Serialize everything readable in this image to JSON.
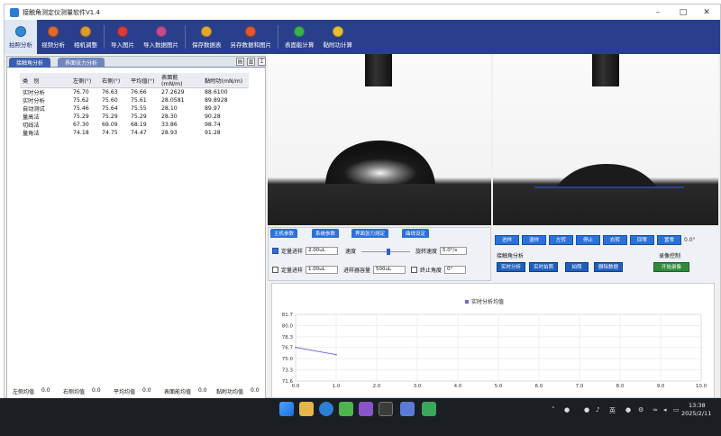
{
  "window": {
    "title": "接触角测定仪测量软件V1.4",
    "controls": [
      "–",
      "□",
      "✕"
    ]
  },
  "toolbar": {
    "items": [
      {
        "label": "拍照分析",
        "icon": "camera-icon",
        "color": "#2f8ad0"
      },
      {
        "label": "视频分析",
        "icon": "video-icon",
        "color": "#e06a2c"
      },
      {
        "label": "相机调整",
        "icon": "camera-adjust-icon",
        "color": "#e09a2c"
      },
      {
        "label": "导入图片",
        "icon": "import-image-icon",
        "color": "#d83b3b"
      },
      {
        "label": "导入数据图片",
        "icon": "import-data-image-icon",
        "color": "#c74b8c"
      },
      {
        "label": "保存数据表",
        "icon": "save-table-icon",
        "color": "#e0a82c"
      },
      {
        "label": "另存数据和图片",
        "icon": "save-as-icon",
        "color": "#e05a2c"
      },
      {
        "label": "表面能计算",
        "icon": "surface-energy-icon",
        "color": "#3cb04f"
      },
      {
        "label": "黏附功计算",
        "icon": "adhesion-work-icon",
        "color": "#e8c02c"
      }
    ]
  },
  "left_tabs": [
    "接触角分析",
    "界面张力分析"
  ],
  "left_tab_buttons": [
    "▤",
    "▥",
    "Σ"
  ],
  "results_table": {
    "headers": [
      "类　别",
      "左侧(°)",
      "右侧(°)",
      "平均值(°)",
      "表面能(mN/m)",
      "黏附功(mN/m)"
    ],
    "rows": [
      [
        "实时分析",
        "76.70",
        "76.63",
        "76.66",
        "27.2629",
        "88.6100"
      ],
      [
        "实时分析",
        "75.62",
        "75.60",
        "75.61",
        "28.0581",
        "89.8928"
      ],
      [
        "自动测试",
        "75.46",
        "75.64",
        "75.55",
        "28.10",
        "89.97"
      ],
      [
        "量高法",
        "75.29",
        "75.29",
        "75.29",
        "28.30",
        "90.28"
      ],
      [
        "切线法",
        "67.30",
        "69.09",
        "68.19",
        "33.86",
        "98.74"
      ],
      [
        "量角法",
        "74.18",
        "74.75",
        "74.47",
        "28.93",
        "91.28"
      ]
    ]
  },
  "summary": [
    {
      "label": "左侧均值",
      "value": "0.0"
    },
    {
      "label": "右侧均值",
      "value": "0.0"
    },
    {
      "label": "平均均值",
      "value": "0.0"
    },
    {
      "label": "表面能均值",
      "value": "0.0"
    },
    {
      "label": "黏附功均值",
      "value": "0.0"
    }
  ],
  "control_tabs": [
    "主机参数",
    "系统参数",
    "界面张力测定",
    "曲线设定"
  ],
  "controls": {
    "row1": {
      "checkbox_label": "定量进样",
      "checked": true,
      "volume": "2.00uL",
      "speed_label": "速度",
      "speed_level": 0.55,
      "rotation_label": "旋转速度",
      "rotation_value": "5.0°/s"
    },
    "row2": {
      "checkbox_label": "定量进样",
      "checked": false,
      "volume": "1.00uL",
      "syringe_label": "进样器容量",
      "syringe_value": "500uL",
      "stop_angle_label": "终止角度",
      "stop_angle_value": "0°"
    }
  },
  "motion_buttons": [
    "进样",
    "退样",
    "左转",
    "停止",
    "右转",
    "回零",
    "置零"
  ],
  "angle_readout": "0.0°",
  "contact_angle_section": {
    "title": "接触角分析",
    "buttons": [
      "实时分析",
      "实时拍照",
      "拍照",
      "删除数据"
    ]
  },
  "camera_section": {
    "title": "录像控制",
    "button": "开始录像"
  },
  "taskbar": {
    "time": "13:38",
    "date": "2025/2/11",
    "ime": "英"
  },
  "chart_data": {
    "type": "line",
    "title": "",
    "series": [
      {
        "name": "实时分析均值",
        "x": [
          0.0,
          1.0
        ],
        "y": [
          76.7,
          75.6
        ],
        "color": "#6a6ad8"
      }
    ],
    "xlim": [
      0.0,
      10.0
    ],
    "ylim": [
      71.6,
      81.7
    ],
    "xticks": [
      "0.0",
      "1.0",
      "2.0",
      "3.0",
      "4.0",
      "5.0",
      "6.0",
      "7.0",
      "8.0",
      "9.0",
      "10.0"
    ],
    "yticks": [
      "81.7",
      "80.0",
      "78.3",
      "76.7",
      "75.0",
      "73.3",
      "71.6"
    ],
    "grid": true,
    "legend": "top-center"
  }
}
